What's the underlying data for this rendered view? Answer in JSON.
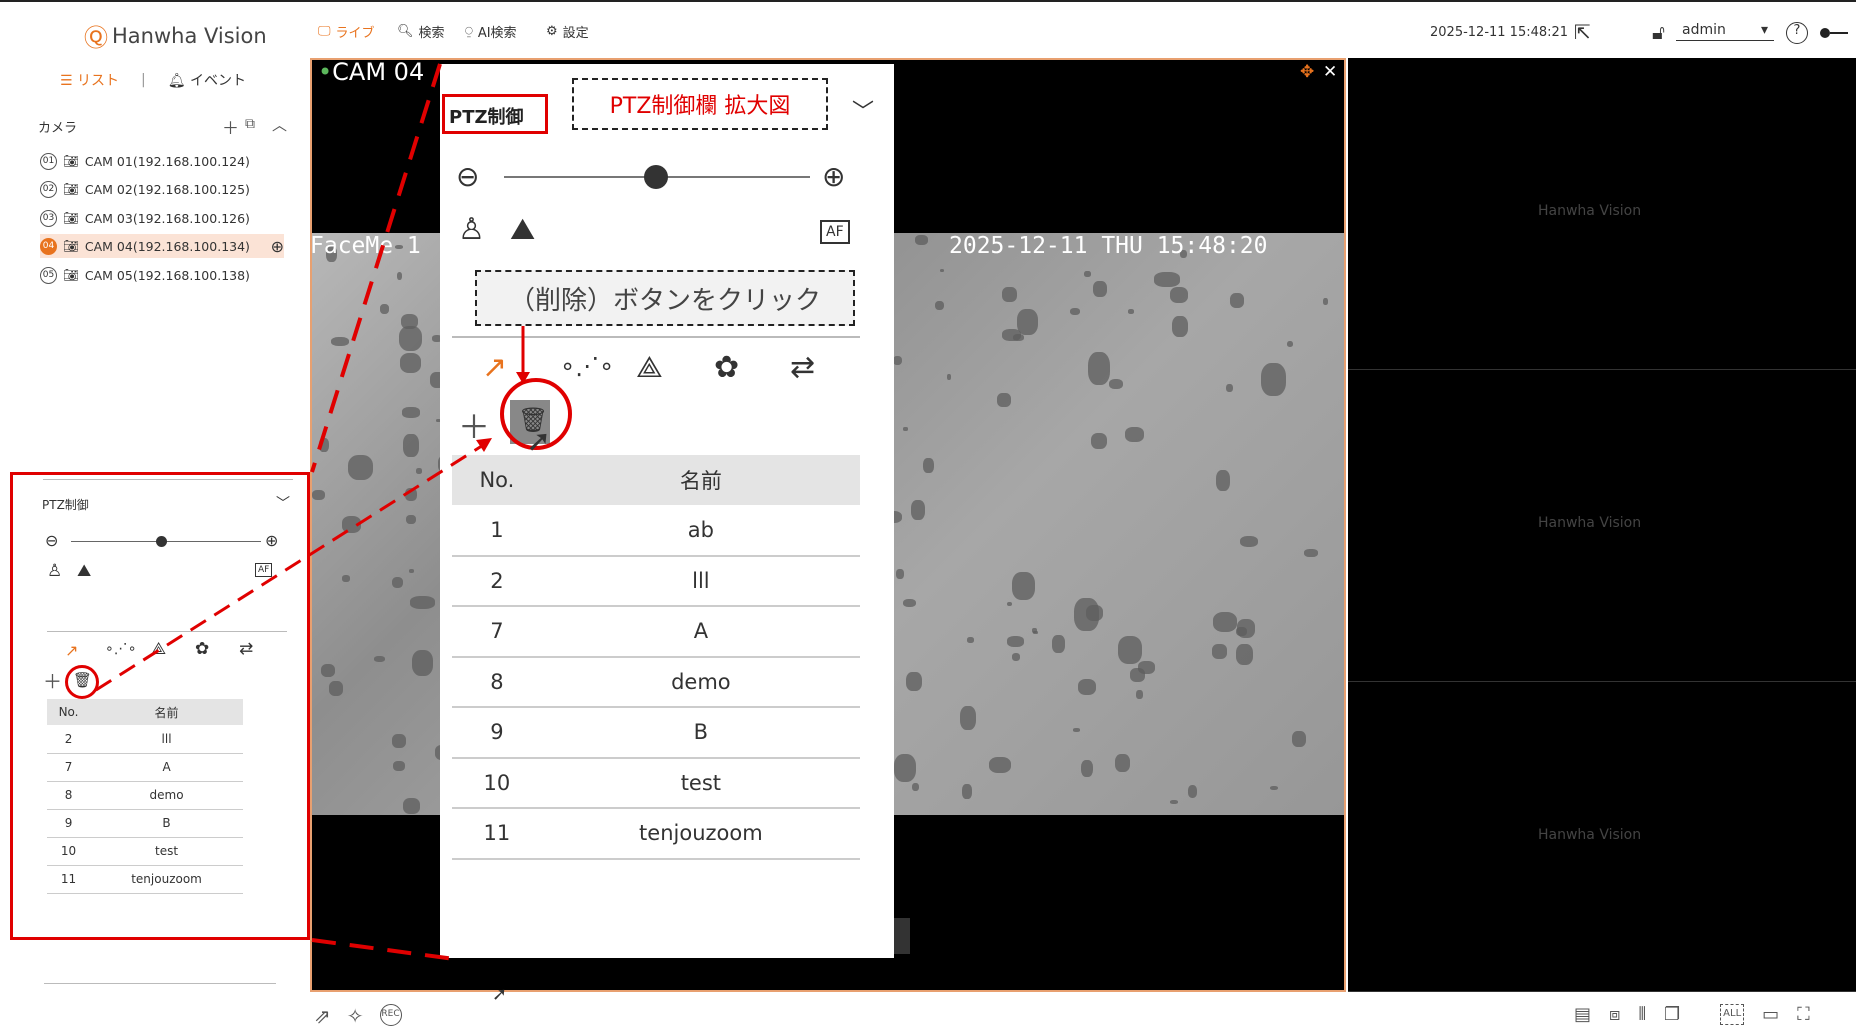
{
  "header": {
    "brand": "Hanwha Vision",
    "nav": [
      {
        "label": "ライブ"
      },
      {
        "label": "検索"
      },
      {
        "label": "AI検索"
      },
      {
        "label": "設定"
      }
    ],
    "datetime": "2025-12-11 15:48:21",
    "user": "admin",
    "accent": "#e8731e"
  },
  "left": {
    "tab_list": "リスト",
    "tab_event": "イベント",
    "camera_header": "カメラ",
    "cameras": [
      {
        "num": "01",
        "label": "CAM 01(192.168.100.124)"
      },
      {
        "num": "02",
        "label": "CAM 02(192.168.100.125)"
      },
      {
        "num": "03",
        "label": "CAM 03(192.168.100.126)"
      },
      {
        "num": "04",
        "label": "CAM 04(192.168.100.134)"
      },
      {
        "num": "05",
        "label": "CAM 05(192.168.100.138)"
      }
    ]
  },
  "small_ptz": {
    "title": "PTZ制御",
    "col_no": "No.",
    "col_name": "名前",
    "rows": [
      {
        "no": "2",
        "name": "lll"
      },
      {
        "no": "7",
        "name": "A"
      },
      {
        "no": "8",
        "name": "demo"
      },
      {
        "no": "9",
        "name": "B"
      },
      {
        "no": "10",
        "name": "test"
      },
      {
        "no": "11",
        "name": "tenjouzoom"
      }
    ]
  },
  "video": {
    "cam_label": "CAM 04",
    "faceme": "FaceMe 1",
    "timestamp": "2025-12-11 THU 15:48:20",
    "watermark": "Hanwha Vision"
  },
  "zoom_ptz": {
    "title": "PTZ制御",
    "annotation": "PTZ制御欄 拡大図",
    "note": "（削除）ボタンをクリック",
    "af": "AF",
    "col_no": "No.",
    "col_name": "名前",
    "rows": [
      {
        "no": "1",
        "name": "ab"
      },
      {
        "no": "2",
        "name": "lll"
      },
      {
        "no": "7",
        "name": "A"
      },
      {
        "no": "8",
        "name": "demo"
      },
      {
        "no": "9",
        "name": "B"
      },
      {
        "no": "10",
        "name": "test"
      },
      {
        "no": "11",
        "name": "tenjouzoom"
      }
    ]
  },
  "bottom": {
    "rec": "REC",
    "all": "ALL"
  }
}
